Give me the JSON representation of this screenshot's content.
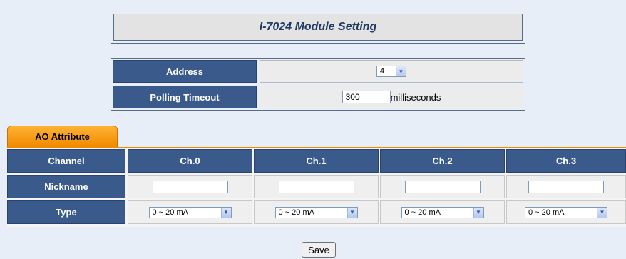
{
  "title": "I-7024 Module Setting",
  "settings": {
    "address_label": "Address",
    "address_value": "4",
    "timeout_label": "Polling Timeout",
    "timeout_value": "300",
    "timeout_unit": "milliseconds"
  },
  "tab": {
    "label": "AO Attribute"
  },
  "table": {
    "corner_label": "Channel",
    "channels": [
      "Ch.0",
      "Ch.1",
      "Ch.2",
      "Ch.3"
    ],
    "nickname_label": "Nickname",
    "nicknames": [
      "",
      "",
      "",
      ""
    ],
    "type_label": "Type",
    "types": [
      "0 ~ 20 mA",
      "0 ~ 20 mA",
      "0 ~ 20 mA",
      "0 ~ 20 mA"
    ]
  },
  "save_label": "Save",
  "colors": {
    "header_blue": "#3b5a8c",
    "tab_orange": "#f08a00",
    "background": "#e8eef8"
  }
}
